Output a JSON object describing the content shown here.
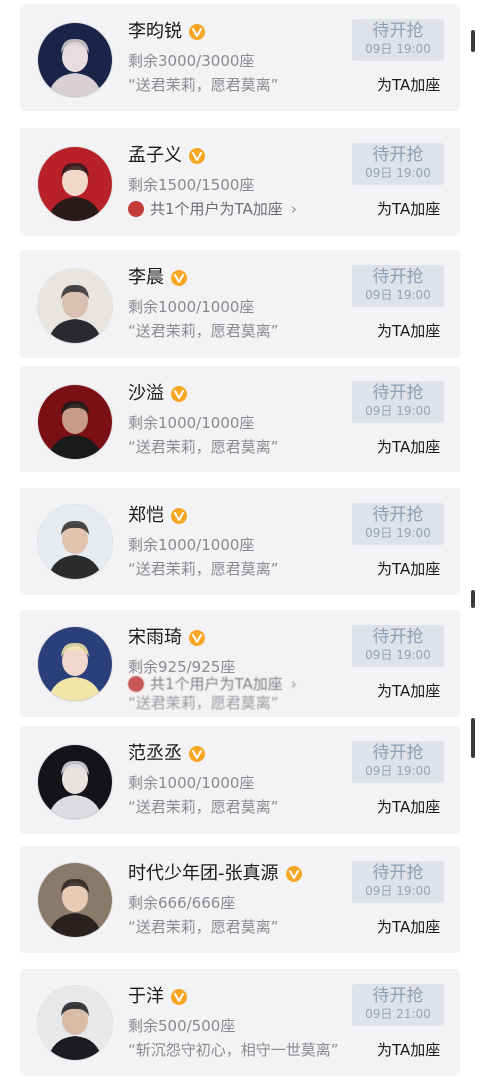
{
  "theme": {
    "badge_color": "#f5a623",
    "status_bg": "#dfe3e9",
    "status_text": "#8e9eb3"
  },
  "cards": [
    {
      "name": "李昀锐",
      "seats": "剩余3000/3000座",
      "line2": "“送君茉莉，愿君莫离”",
      "line2_type": "slogan",
      "status": "待开抢",
      "time": "09日 19:00",
      "action": "为TA加座",
      "avatar_colors": [
        "#1a2448",
        "#d8d0d4",
        "#e9dce0"
      ]
    },
    {
      "name": "孟子义",
      "seats": "剩余1500/1500座",
      "line2": "共1个用户为TA加座",
      "line2_type": "users",
      "status": "待开抢",
      "time": "09日 19:00",
      "action": "为TA加座",
      "avatar_colors": [
        "#b8202a",
        "#2a1a1a",
        "#f2d8c8"
      ]
    },
    {
      "name": "李晨",
      "seats": "剩余1000/1000座",
      "line2": "“送君茉莉，愿君莫离”",
      "line2_type": "slogan",
      "status": "待开抢",
      "time": "09日 19:00",
      "action": "为TA加座",
      "avatar_colors": [
        "#e8e4e0",
        "#2a2a2e",
        "#d9c0b0"
      ]
    },
    {
      "name": "沙溢",
      "seats": "剩余1000/1000座",
      "line2": "“送君茉莉，愿君莫离”",
      "line2_type": "slogan",
      "status": "待开抢",
      "time": "09日 19:00",
      "action": "为TA加座",
      "avatar_colors": [
        "#7a1016",
        "#1a1a1a",
        "#c89a88"
      ]
    },
    {
      "name": "郑恺",
      "seats": "剩余1000/1000座",
      "line2": "“送君茉莉，愿君莫离”",
      "line2_type": "slogan",
      "status": "待开抢",
      "time": "09日 19:00",
      "action": "为TA加座",
      "avatar_colors": [
        "#e6ecef",
        "#2b2b2b",
        "#e2c4ae"
      ]
    },
    {
      "name": "宋雨琦",
      "seats": "剩余925/925座",
      "line2": "共1个用户为TA加座",
      "line2_type": "users-blurred",
      "line3": "“送君茉莉，愿君莫离”",
      "status": "待开抢",
      "time": "09日 19:00",
      "action": "为TA加座",
      "avatar_colors": [
        "#2b3f7a",
        "#f1e6a8",
        "#f2d8cc"
      ]
    },
    {
      "name": "范丞丞",
      "seats": "剩余1000/1000座",
      "line2": "“送君茉莉，愿君莫离”",
      "line2_type": "slogan",
      "status": "待开抢",
      "time": "09日 19:00",
      "action": "为TA加座",
      "avatar_colors": [
        "#121418",
        "#dcdde0",
        "#e8e2e0"
      ]
    },
    {
      "name": "时代少年团-张真源",
      "seats": "剩余666/666座",
      "line2": "“送君茉莉，愿君莫离”",
      "line2_type": "slogan",
      "status": "待开抢",
      "time": "09日 19:00",
      "action": "为TA加座",
      "avatar_colors": [
        "#8a7a6a",
        "#2a2220",
        "#e6ccb6"
      ]
    },
    {
      "name": "于洋",
      "seats": "剩余500/500座",
      "line2": "“斩沉怨守初心，相守一世莫离”",
      "line2_type": "slogan",
      "status": "待开抢",
      "time": "09日 21:00",
      "action": "为TA加座",
      "avatar_colors": [
        "#e6e8ea",
        "#1a1c20",
        "#d8bca8"
      ]
    }
  ]
}
